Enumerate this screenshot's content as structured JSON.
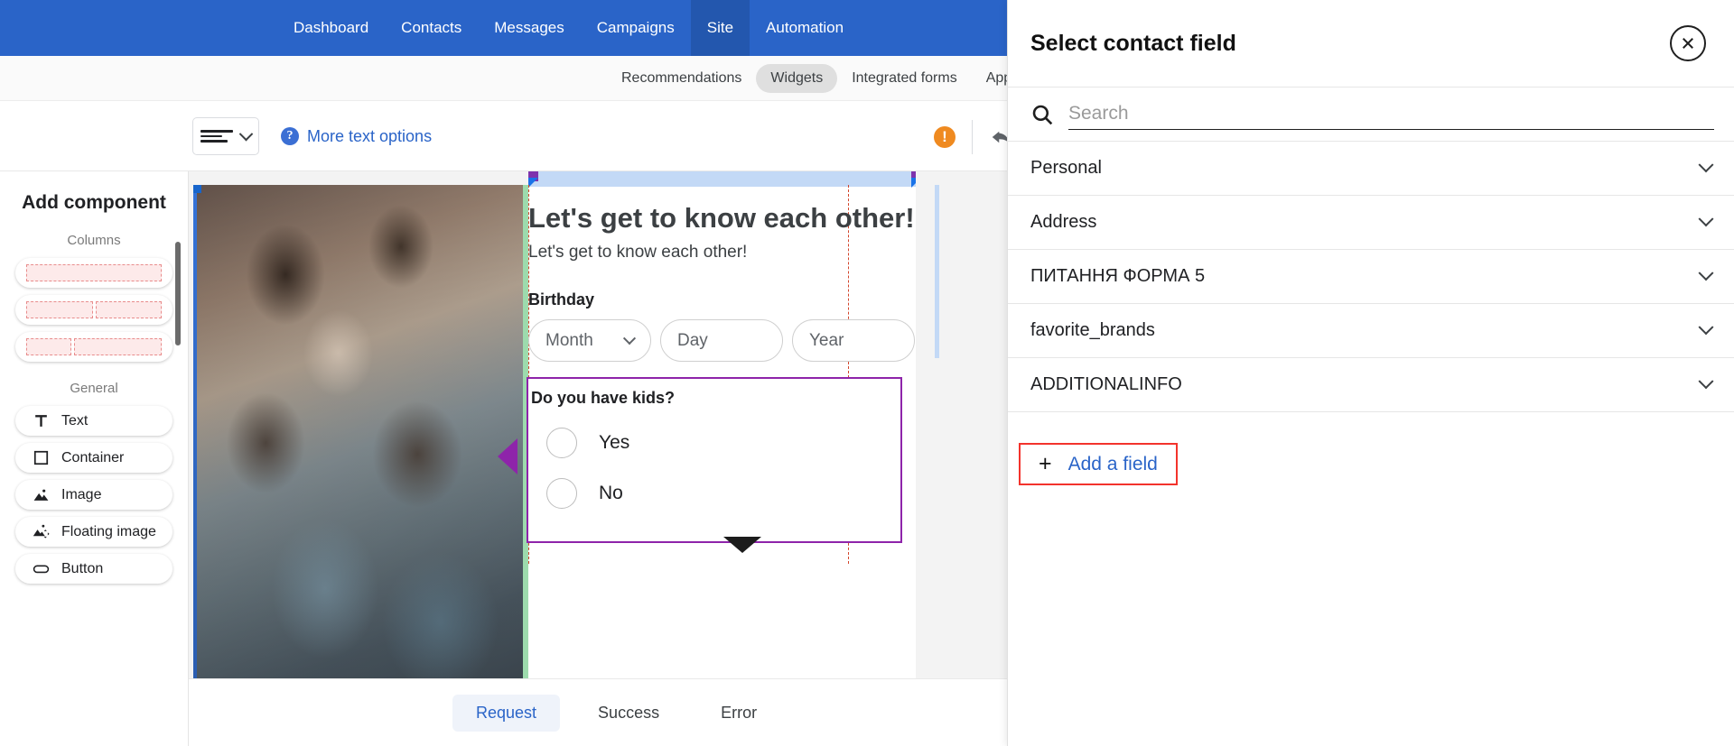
{
  "topnav": {
    "items": [
      {
        "label": "Dashboard",
        "active": false
      },
      {
        "label": "Contacts",
        "active": false
      },
      {
        "label": "Messages",
        "active": false
      },
      {
        "label": "Campaigns",
        "active": false
      },
      {
        "label": "Site",
        "active": true
      },
      {
        "label": "Automation",
        "active": false
      }
    ],
    "bell_icon": "bell-icon",
    "brand_color": "#2a64c8"
  },
  "subnav": {
    "items": [
      {
        "label": "Recommendations",
        "active": false
      },
      {
        "label": "Widgets",
        "active": true
      },
      {
        "label": "Integrated forms",
        "active": false
      },
      {
        "label": "App In",
        "active": false
      }
    ]
  },
  "toolbar": {
    "align_icon": "text-align-icon",
    "align_chevron": "chevron-down-icon",
    "more_text_options": "More text options",
    "help_icon": "question-mark-icon",
    "error_icon": "alert-icon",
    "error_color": "#ef8a20",
    "undo_icon": "undo-arrow-icon"
  },
  "sidebar": {
    "title": "Add component",
    "columns_label": "Columns",
    "columns": [
      {
        "name": "one-column-layout",
        "segments": [
          1
        ]
      },
      {
        "name": "two-column-equal-layout",
        "segments": [
          1,
          1
        ]
      },
      {
        "name": "two-column-narrow-wide-layout",
        "segments": [
          1,
          2
        ]
      }
    ],
    "general_label": "General",
    "general": [
      {
        "label": "Text",
        "icon": "text-icon"
      },
      {
        "label": "Container",
        "icon": "container-icon"
      },
      {
        "label": "Image",
        "icon": "image-icon"
      },
      {
        "label": "Floating image",
        "icon": "floating-image-icon"
      },
      {
        "label": "Button",
        "icon": "button-icon"
      }
    ]
  },
  "canvas": {
    "form": {
      "heading": "Let's get to know each other!",
      "subheading": "Let's get to know each other!",
      "birthday_label": "Birthday",
      "birthday_fields": [
        {
          "placeholder": "Month",
          "has_chevron": true
        },
        {
          "placeholder": "Day",
          "has_chevron": false
        },
        {
          "placeholder": "Year",
          "has_chevron": false
        }
      ],
      "kids_question": "Do you have kids?",
      "kids_options": [
        "Yes",
        "No"
      ]
    },
    "selection_color": "#8e24aa",
    "guide_color": "#d3452b",
    "highlight_color": "#c3d9f6",
    "green_bar_color": "#9ddbad"
  },
  "bottom_tabs": {
    "items": [
      {
        "label": "Request",
        "active": true
      },
      {
        "label": "Success",
        "active": false
      },
      {
        "label": "Error",
        "active": false
      }
    ]
  },
  "panel": {
    "title": "Select contact field",
    "close_icon": "close-circle-icon",
    "search": {
      "icon": "search-icon",
      "placeholder": "Search",
      "value": ""
    },
    "fields": [
      {
        "label": "Personal"
      },
      {
        "label": "Address"
      },
      {
        "label": "ПИТАННЯ ФОРМА 5"
      },
      {
        "label": "favorite_brands"
      },
      {
        "label": "ADDITIONALINFO"
      }
    ],
    "add_field": {
      "label": "Add a field",
      "plus_icon": "plus-icon",
      "highlight_color": "#f3332c"
    }
  }
}
